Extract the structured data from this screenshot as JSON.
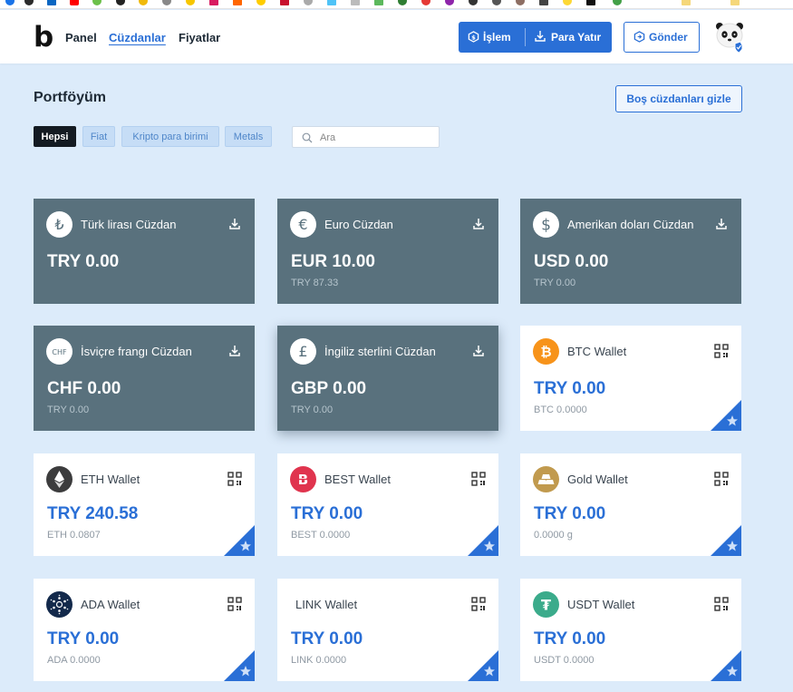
{
  "nav": {
    "logo": "b",
    "links": [
      "Panel",
      "Cüzdanlar",
      "Fiyatlar"
    ],
    "trade_label": "İşlem",
    "deposit_label": "Para Yatır",
    "send_label": "Gönder"
  },
  "portfolio": {
    "title": "Portföyüm",
    "hide_empty_label": "Boş cüzdanları gizle",
    "filters": [
      "Hepsi",
      "Fiat",
      "Kripto para birimi",
      "Metals"
    ],
    "search_placeholder": "Ara"
  },
  "wallets": [
    {
      "name": "Türk lirası Cüzdan",
      "amount": "TRY 0.00",
      "sub": "",
      "icon": "lira-icon",
      "glyph": "₺",
      "type": "fiat"
    },
    {
      "name": "Euro Cüzdan",
      "amount": "EUR 10.00",
      "sub": "TRY 87.33",
      "icon": "euro-icon",
      "glyph": "€",
      "type": "fiat"
    },
    {
      "name": "Amerikan doları Cüzdan",
      "amount": "USD 0.00",
      "sub": "TRY 0.00",
      "icon": "dollar-icon",
      "glyph": "$",
      "type": "fiat"
    },
    {
      "name": "İsviçre frangı Cüzdan",
      "amount": "CHF 0.00",
      "sub": "TRY 0.00",
      "icon": "franc-icon",
      "glyph": "CHF",
      "type": "fiat"
    },
    {
      "name": "İngiliz sterlini Cüzdan",
      "amount": "GBP 0.00",
      "sub": "TRY 0.00",
      "icon": "pound-icon",
      "glyph": "£",
      "type": "fiat"
    },
    {
      "name": "BTC Wallet",
      "amount": "TRY 0.00",
      "sub": "BTC 0.0000",
      "icon": "bitcoin-icon",
      "glyph": "₿",
      "type": "crypto"
    },
    {
      "name": "ETH Wallet",
      "amount": "TRY 240.58",
      "sub": "ETH 0.0807",
      "icon": "ethereum-icon",
      "glyph": "",
      "type": "crypto"
    },
    {
      "name": "BEST Wallet",
      "amount": "TRY 0.00",
      "sub": "BEST 0.0000",
      "icon": "best-icon",
      "glyph": "B",
      "type": "crypto"
    },
    {
      "name": "Gold Wallet",
      "amount": "TRY 0.00",
      "sub": "0.0000 g",
      "icon": "gold-bars-icon",
      "glyph": "",
      "type": "crypto"
    },
    {
      "name": "ADA Wallet",
      "amount": "TRY 0.00",
      "sub": "ADA 0.0000",
      "icon": "cardano-icon",
      "glyph": "",
      "type": "crypto"
    },
    {
      "name": "LINK Wallet",
      "amount": "TRY 0.00",
      "sub": "LINK 0.0000",
      "icon": "",
      "glyph": "",
      "type": "crypto"
    },
    {
      "name": "USDT Wallet",
      "amount": "TRY 0.00",
      "sub": "USDT 0.0000",
      "icon": "tether-icon",
      "glyph": "₮",
      "type": "crypto"
    }
  ],
  "colors": {
    "accent": "#2a6fd6",
    "fiat_card": "#59717d",
    "page_bg": "#dcebfa",
    "bitcoin": "#f7931a",
    "best": "#e0344e",
    "ethereum": "#3c3c3d",
    "gold": "#c19a4e",
    "cardano": "#13294b",
    "tether": "#3bab8b"
  }
}
